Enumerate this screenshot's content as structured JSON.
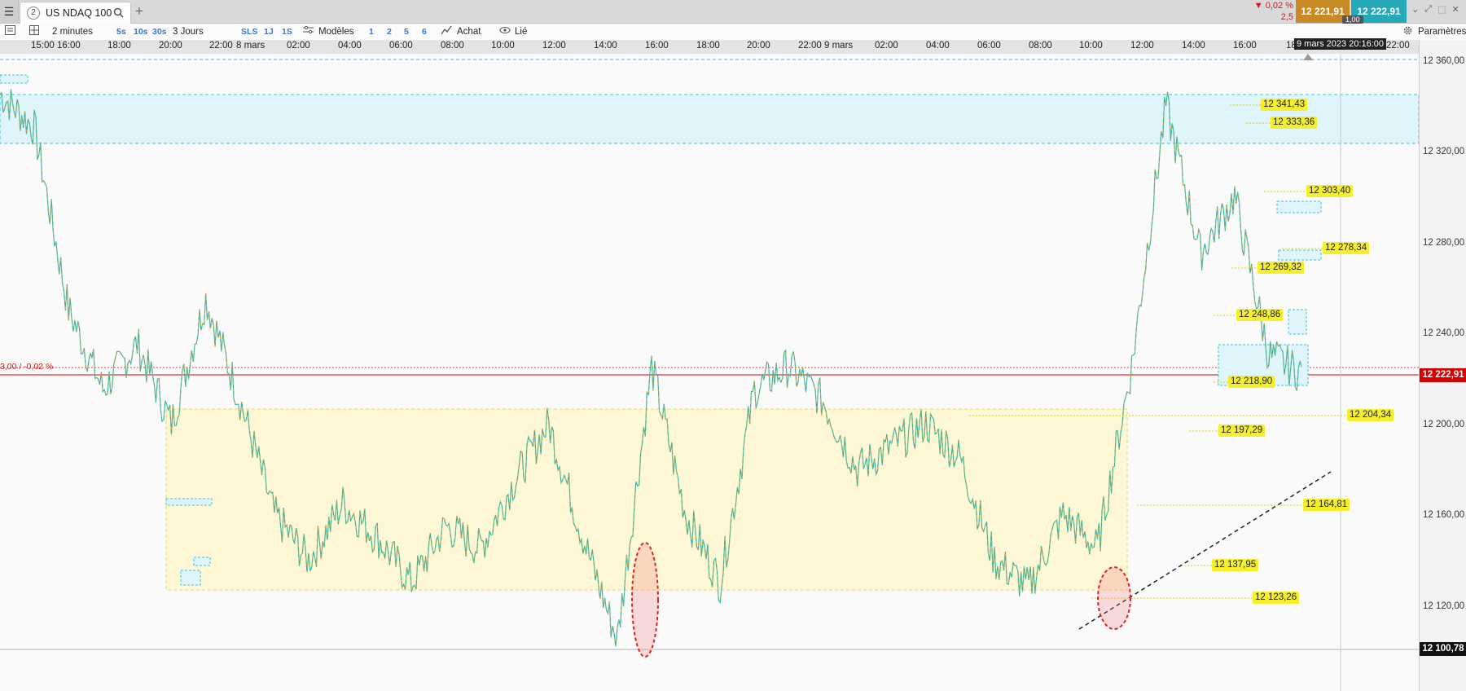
{
  "tabbar": {
    "tab_number": "2",
    "tab_title": "US NDAQ 100",
    "add_tab": "+",
    "change_pct": "▼ 0,02 %",
    "change_pts": "2,5",
    "bid": "12 221,91",
    "ask": "12 222,91",
    "quantity": "1,00",
    "window_controls": [
      "⌄",
      "⤢",
      "⬚",
      "✕"
    ]
  },
  "toolbar": {
    "timeframe": "2 minutes",
    "quick_timeframes": [
      "5s",
      "10s",
      "30s"
    ],
    "period": "3 Jours",
    "views": [
      "SLS",
      "1J",
      "1S"
    ],
    "templates_label": "Modèles",
    "layouts": [
      "1",
      "2",
      "5",
      "6"
    ],
    "buy_label": "Achat",
    "link_label": "Lié",
    "settings_label": "Paramètres"
  },
  "time_axis": {
    "labels": [
      "15:00",
      "16:00",
      "18:00",
      "20:00",
      "22:00",
      "8 mars",
      "02:00",
      "04:00",
      "06:00",
      "08:00",
      "10:00",
      "12:00",
      "14:00",
      "16:00",
      "18:00",
      "20:00",
      "22:00",
      "9 mars",
      "02:00",
      "04:00",
      "06:00",
      "08:00",
      "10:00",
      "12:00",
      "14:00",
      "16:00",
      "18",
      "22:00"
    ],
    "cursor_date": "9 mars 2023 20:16:00"
  },
  "chart_data": {
    "type": "candlestick",
    "instrument": "US NDAQ 100",
    "timeframe": "2 minutes",
    "price_axis": [
      "12 360,00",
      "12 320,00",
      "12 280,00",
      "12 240,00",
      "12 200,00",
      "12 160,00",
      "12 120,00"
    ],
    "ylim": [
      12080,
      12370
    ],
    "current_price": "12 222,91",
    "prev_close_label": "3,00 / -0,02 %",
    "session_low": "12 100,78",
    "price_levels": [
      "12 341,43",
      "12 333,36",
      "12 303,40",
      "12 278,34",
      "12 269,32",
      "12 248,86",
      "12 218,90",
      "12 204,34",
      "12 197,29",
      "12 164,81",
      "12 137,95",
      "12 123,26"
    ],
    "overview_points": [
      {
        "t": 0,
        "p": 12345
      },
      {
        "t": 1,
        "p": 12330
      },
      {
        "t": 2,
        "p": 12250
      },
      {
        "t": 3,
        "p": 12215
      },
      {
        "t": 4,
        "p": 12235
      },
      {
        "t": 5,
        "p": 12200
      },
      {
        "t": 6,
        "p": 12255
      },
      {
        "t": 7,
        "p": 12210
      },
      {
        "t": 8,
        "p": 12160
      },
      {
        "t": 9,
        "p": 12140
      },
      {
        "t": 10,
        "p": 12165
      },
      {
        "t": 11,
        "p": 12150
      },
      {
        "t": 12,
        "p": 12130
      },
      {
        "t": 13,
        "p": 12155
      },
      {
        "t": 14,
        "p": 12145
      },
      {
        "t": 15,
        "p": 12175
      },
      {
        "t": 16,
        "p": 12200
      },
      {
        "t": 17,
        "p": 12150
      },
      {
        "t": 18,
        "p": 12105
      },
      {
        "t": 19,
        "p": 12225
      },
      {
        "t": 20,
        "p": 12160
      },
      {
        "t": 21,
        "p": 12130
      },
      {
        "t": 22,
        "p": 12215
      },
      {
        "t": 23,
        "p": 12225
      },
      {
        "t": 24,
        "p": 12210
      },
      {
        "t": 25,
        "p": 12180
      },
      {
        "t": 26,
        "p": 12190
      },
      {
        "t": 27,
        "p": 12200
      },
      {
        "t": 28,
        "p": 12185
      },
      {
        "t": 29,
        "p": 12140
      },
      {
        "t": 30,
        "p": 12128
      },
      {
        "t": 31,
        "p": 12160
      },
      {
        "t": 32,
        "p": 12145
      },
      {
        "t": 33,
        "p": 12225
      },
      {
        "t": 34,
        "p": 12340
      },
      {
        "t": 35,
        "p": 12275
      },
      {
        "t": 36,
        "p": 12300
      },
      {
        "t": 37,
        "p": 12230
      },
      {
        "t": 38,
        "p": 12222
      }
    ]
  }
}
